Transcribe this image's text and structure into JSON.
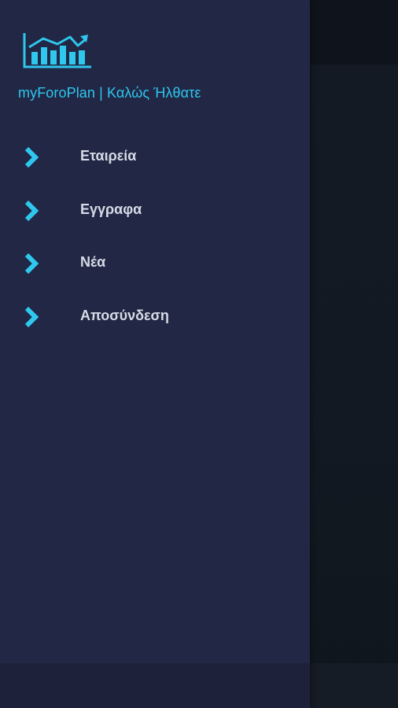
{
  "app": {
    "header_title": "myForoPlan | Καλώς Ήλθατε",
    "logo_icon": "bar-chart-trend-icon",
    "accent_color": "#2fc7ee",
    "drawer_color": "#212745"
  },
  "menu": {
    "items": [
      {
        "label": "Εταιρεία",
        "icon": "chevron-right-icon"
      },
      {
        "label": "Εγγραφα",
        "icon": "chevron-right-icon"
      },
      {
        "label": "Νέα",
        "icon": "chevron-right-icon"
      },
      {
        "label": "Αποσύνδεση",
        "icon": "chevron-right-icon"
      }
    ]
  }
}
